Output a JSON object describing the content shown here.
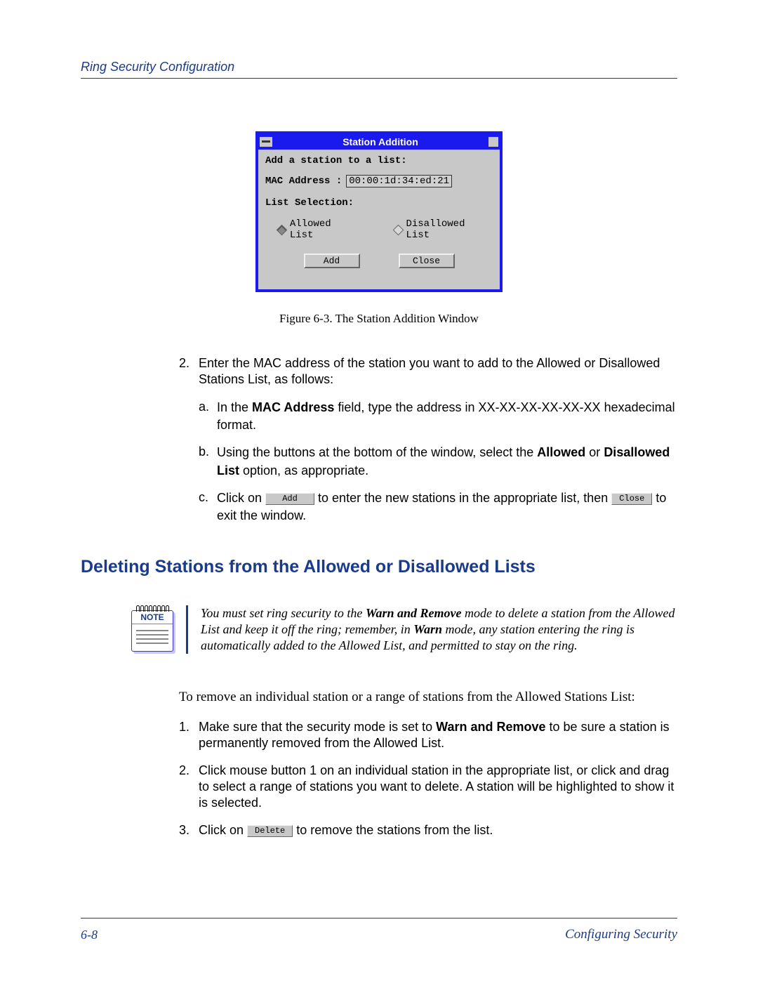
{
  "header": {
    "title": "Ring Security Configuration"
  },
  "dialog": {
    "title": "Station Addition",
    "line1": "Add a station to a list:",
    "mac_label": "MAC Address :",
    "mac_value": "00:00:1d:34:ed:21",
    "list_selection_label": "List Selection:",
    "radio_allowed": "Allowed List",
    "radio_disallowed": "Disallowed List",
    "btn_add": "Add",
    "btn_close": "Close"
  },
  "figure_caption": "Figure 6-3. The Station Addition Window",
  "step2": {
    "num": "2.",
    "text": "Enter the MAC address of the station you want to add to the Allowed or Disallowed Stations List, as follows:"
  },
  "sub_a": {
    "letter": "a.",
    "pre": "In the ",
    "bold": "MAC Address",
    "post": " field, type the address in XX-XX-XX-XX-XX-XX hexadecimal format."
  },
  "sub_b": {
    "letter": "b.",
    "pre": "Using the buttons at the bottom of the window, select the ",
    "bold1": "Allowed",
    "mid": " or ",
    "bold2": "Disallowed List",
    "post": " option, as appropriate."
  },
  "sub_c": {
    "letter": "c.",
    "pre": "Click on ",
    "btn1": "Add",
    "mid": " to enter the new stations in the appropriate list, then ",
    "btn2": "Close",
    "post": " to exit the window."
  },
  "heading2": "Deleting Stations from the Allowed or Disallowed Lists",
  "note": {
    "label": "NOTE",
    "t1": "You must set ring security to the ",
    "b1": "Warn and Remove",
    "t2": " mode to delete a station from the Allowed List and keep it off the ring; remember, in ",
    "b2": "Warn",
    "t3": " mode, any station entering the ring is automatically added to the Allowed List, and permitted to stay on the ring."
  },
  "para_remove": "To remove an individual station or a range of stations from the Allowed Stations List:",
  "del1": {
    "num": "1.",
    "pre": "Make sure that the security mode is set to ",
    "bold": "Warn and Remove",
    "post": " to be sure a station is permanently removed from the Allowed List."
  },
  "del2": {
    "num": "2.",
    "text": "Click mouse button 1 on an individual station in the appropriate list, or click and drag to select a range of stations you want to delete. A station will be highlighted to show it is selected."
  },
  "del3": {
    "num": "3.",
    "pre": "Click on ",
    "btn": "Delete",
    "post": " to remove the stations from the list."
  },
  "footer": {
    "page": "6-8",
    "title": "Configuring Security"
  }
}
